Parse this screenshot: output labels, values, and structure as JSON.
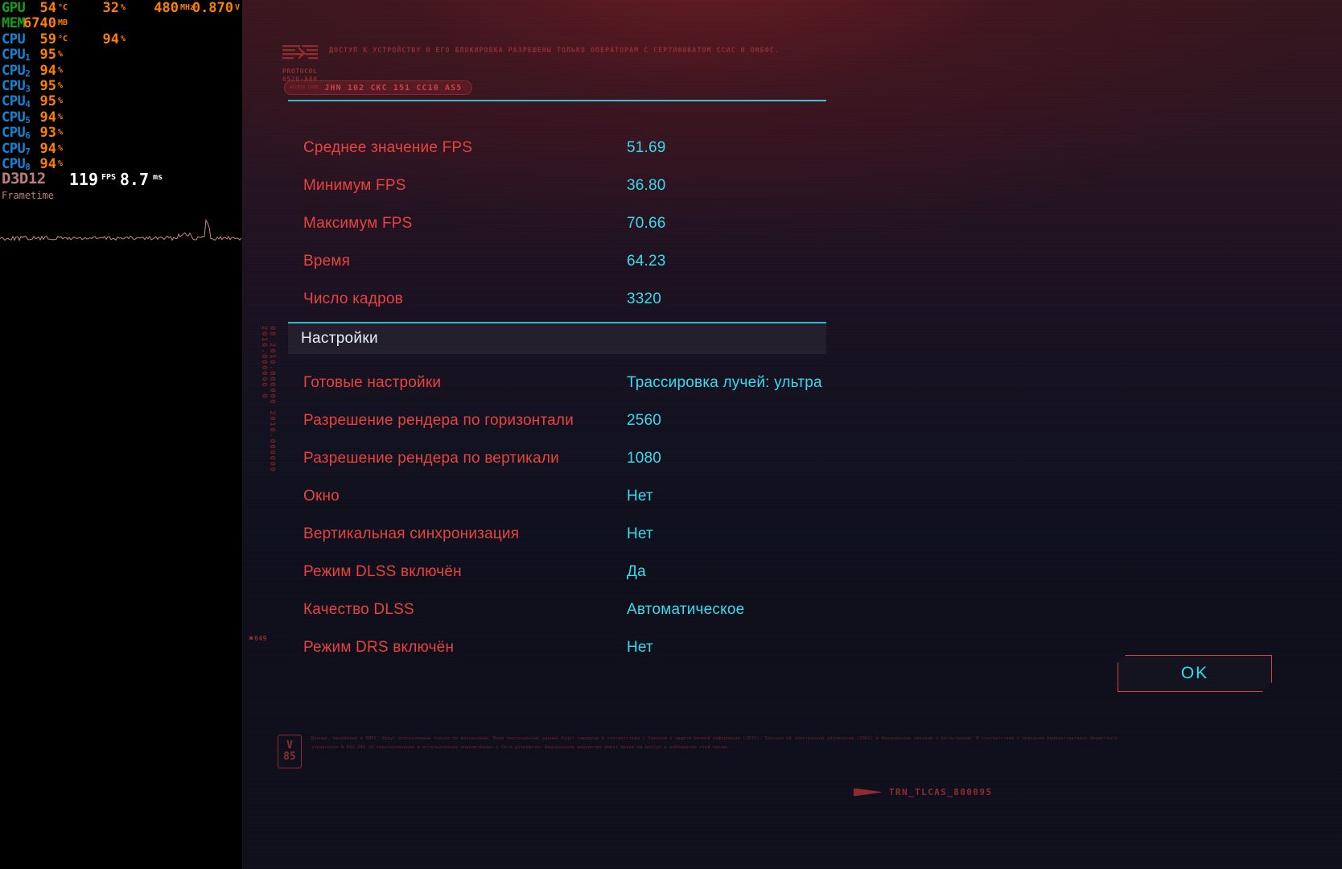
{
  "overlay": {
    "rows": [
      {
        "label": "GPU",
        "sub": "",
        "metrics": [
          {
            "value": "54",
            "unit": "°C"
          },
          {
            "value": "32",
            "unit": "%"
          },
          {
            "value": "480",
            "unit": "MHz"
          },
          {
            "value": "0.870",
            "unit": "V"
          }
        ]
      },
      {
        "label": "MEM",
        "sub": "",
        "metrics": [
          {
            "value": "6740",
            "unit": "MB"
          }
        ]
      },
      {
        "label": "CPU",
        "sub": "",
        "metrics": [
          {
            "value": "59",
            "unit": "°C"
          },
          {
            "value": "94",
            "unit": "%"
          }
        ]
      },
      {
        "label": "CPU",
        "sub": "1",
        "metrics": [
          {
            "value": "95",
            "unit": "%"
          }
        ]
      },
      {
        "label": "CPU",
        "sub": "2",
        "metrics": [
          {
            "value": "94",
            "unit": "%"
          }
        ]
      },
      {
        "label": "CPU",
        "sub": "3",
        "metrics": [
          {
            "value": "95",
            "unit": "%"
          }
        ]
      },
      {
        "label": "CPU",
        "sub": "4",
        "metrics": [
          {
            "value": "95",
            "unit": "%"
          }
        ]
      },
      {
        "label": "CPU",
        "sub": "5",
        "metrics": [
          {
            "value": "94",
            "unit": "%"
          }
        ]
      },
      {
        "label": "CPU",
        "sub": "6",
        "metrics": [
          {
            "value": "93",
            "unit": "%"
          }
        ]
      },
      {
        "label": "CPU",
        "sub": "7",
        "metrics": [
          {
            "value": "94",
            "unit": "%"
          }
        ]
      },
      {
        "label": "CPU",
        "sub": "8",
        "metrics": [
          {
            "value": "94",
            "unit": "%"
          }
        ]
      }
    ],
    "api_row": {
      "label": "D3D12",
      "fps": "119",
      "fps_unit": "FPS",
      "ms": "8.7",
      "ms_unit": "ms"
    },
    "frametime_label": "Frametime",
    "frametime_scale": "8.7 ms",
    "colors": {
      "gpu_label": "#17a11b",
      "cpu_label": "#1384d6",
      "value": "#ff8000",
      "api_label": "#b97f7f",
      "white": "#ffffff"
    }
  },
  "panel": {
    "brand": {
      "code_line1": "PROTOCOL",
      "code_line2": "6520-A44",
      "notice": "ДОСТУП К УСТРОЙСТВУ И ЕГО БЛОКИРОВКА\nРАЗРЕШЕНЫ ТОЛЬКО ОПЕРАТОРАМ С\nСЕРТИФИКАТОМ ССИС И ОНБФС."
    },
    "id_badge": {
      "micro": "ACCESS CODE",
      "code": "JHN 102 CKC 151 CC10 AS5"
    },
    "vertical_ticker": "08 2016.000000 2016.000000 2016.000000 0",
    "marker": "649",
    "results": [
      {
        "label": "Среднее значение FPS",
        "value": "51.69"
      },
      {
        "label": "Минимум FPS",
        "value": "36.80"
      },
      {
        "label": "Максимум FPS",
        "value": "70.66"
      },
      {
        "label": "Время",
        "value": "64.23"
      },
      {
        "label": "Число кадров",
        "value": "3320"
      }
    ],
    "settings_title": "Настройки",
    "settings": [
      {
        "label": "Готовые настройки",
        "value": "Трассировка лучей: ультра"
      },
      {
        "label": "Разрешение рендера по горизонтали",
        "value": "2560"
      },
      {
        "label": "Разрешение рендера по вертикали",
        "value": "1080"
      },
      {
        "label": "Окно",
        "value": "Нет"
      },
      {
        "label": "Вертикальная синхронизация",
        "value": "Нет"
      },
      {
        "label": "Режим DLSS включён",
        "value": "Да"
      },
      {
        "label": "Качество DLSS",
        "value": "Автоматическое"
      },
      {
        "label": "Режим DRS включён",
        "value": "Нет"
      }
    ],
    "ok_button": "OK",
    "footer": {
      "badge_top": "V",
      "badge_bottom": "85",
      "legal": "Данные, введённые в РИРС, будут использованы только по назначению. Ваши персональные данные будут защищены в соответствии с Законом о защите личной информации (2015), Законом об электронном управлении (2002) и Федеральным законом о регистрации. В соответствии с приказом Административно-бюджетного управления № 022-242 «О персонализации и использовании подключённых к Сети устройств» федеральное ведомство имеет право на доступ к наблюдению этой маски.",
      "code": "TRN_TLCAS_800095"
    },
    "colors": {
      "key": "#e8413f",
      "value": "#36dced",
      "accent_line": "#35b8c4",
      "border": "#d4453f",
      "decor": "#8e2b2e"
    }
  }
}
